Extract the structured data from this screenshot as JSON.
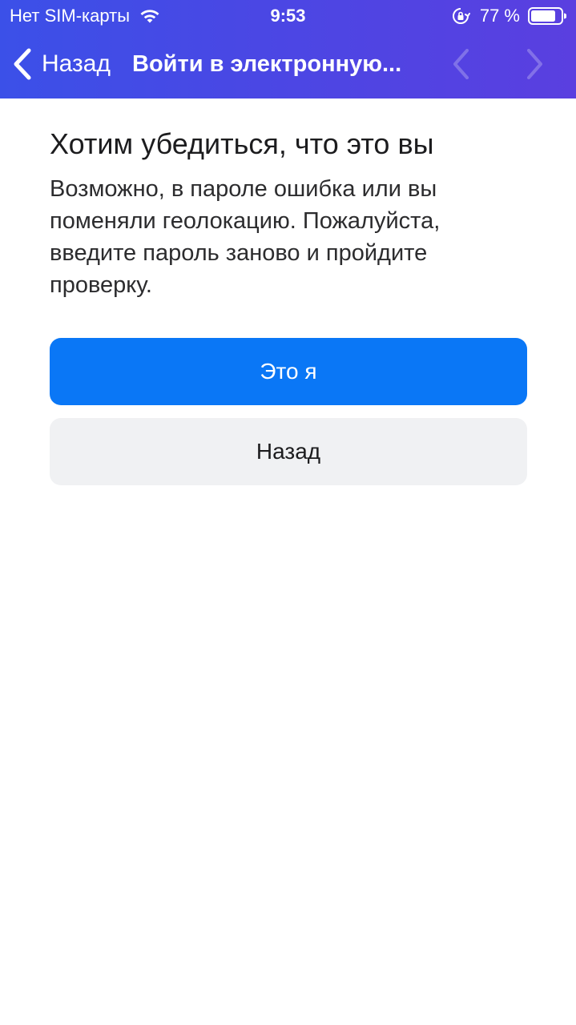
{
  "status_bar": {
    "carrier": "Нет SIM-карты",
    "time": "9:53",
    "battery": "77 %"
  },
  "nav": {
    "back_label": "Назад",
    "title": "Войти в электронную..."
  },
  "content": {
    "heading": "Хотим убедиться, что это вы",
    "description": "Возможно, в пароле ошибка или вы поменяли геолокацию. Пожалуйста, введите пароль заново и пройдите проверку."
  },
  "buttons": {
    "confirm_label": "Это я",
    "back_label": "Назад"
  },
  "colors": {
    "header_gradient_start": "#3b50e8",
    "header_gradient_end": "#5a3fe0",
    "primary_button": "#0a77f6",
    "secondary_button": "#f0f1f3"
  },
  "icons": {
    "wifi": "wifi-icon",
    "rotation_lock": "rotation-lock-icon",
    "battery": "battery-icon",
    "back": "chevron-left-icon",
    "prev": "chevron-left-icon",
    "next": "chevron-right-icon"
  }
}
